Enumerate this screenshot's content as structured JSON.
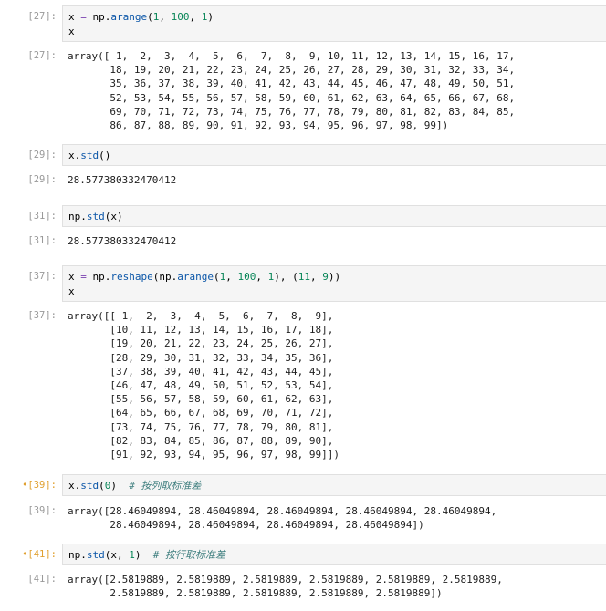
{
  "cells": [
    {
      "type": "in",
      "prompt": "[27]:",
      "code": [
        [
          {
            "t": "x ",
            "c": "kw"
          },
          {
            "t": "=",
            "c": "op"
          },
          {
            "t": " np.",
            "c": "kw"
          },
          {
            "t": "arange",
            "c": "fn"
          },
          {
            "t": "(",
            "c": "kw"
          },
          {
            "t": "1",
            "c": "num"
          },
          {
            "t": ", ",
            "c": "kw"
          },
          {
            "t": "100",
            "c": "num"
          },
          {
            "t": ", ",
            "c": "kw"
          },
          {
            "t": "1",
            "c": "num"
          },
          {
            "t": ")",
            "c": "kw"
          }
        ],
        [
          {
            "t": "x",
            "c": "kw"
          }
        ]
      ]
    },
    {
      "type": "out",
      "prompt": "[27]:",
      "lines": [
        "array([ 1,  2,  3,  4,  5,  6,  7,  8,  9, 10, 11, 12, 13, 14, 15, 16, 17,",
        "       18, 19, 20, 21, 22, 23, 24, 25, 26, 27, 28, 29, 30, 31, 32, 33, 34,",
        "       35, 36, 37, 38, 39, 40, 41, 42, 43, 44, 45, 46, 47, 48, 49, 50, 51,",
        "       52, 53, 54, 55, 56, 57, 58, 59, 60, 61, 62, 63, 64, 65, 66, 67, 68,",
        "       69, 70, 71, 72, 73, 74, 75, 76, 77, 78, 79, 80, 81, 82, 83, 84, 85,",
        "       86, 87, 88, 89, 90, 91, 92, 93, 94, 95, 96, 97, 98, 99])"
      ]
    },
    {
      "type": "in",
      "prompt": "[29]:",
      "code": [
        [
          {
            "t": "x.",
            "c": "kw"
          },
          {
            "t": "std",
            "c": "fn"
          },
          {
            "t": "()",
            "c": "kw"
          }
        ]
      ]
    },
    {
      "type": "out",
      "prompt": "[29]:",
      "lines": [
        "28.577380332470412"
      ]
    },
    {
      "type": "in",
      "prompt": "[31]:",
      "code": [
        [
          {
            "t": "np.",
            "c": "kw"
          },
          {
            "t": "std",
            "c": "fn"
          },
          {
            "t": "(x)",
            "c": "kw"
          }
        ]
      ]
    },
    {
      "type": "out",
      "prompt": "[31]:",
      "lines": [
        "28.577380332470412"
      ]
    },
    {
      "type": "in",
      "prompt": "[37]:",
      "code": [
        [
          {
            "t": "x ",
            "c": "kw"
          },
          {
            "t": "=",
            "c": "op"
          },
          {
            "t": " np.",
            "c": "kw"
          },
          {
            "t": "reshape",
            "c": "fn"
          },
          {
            "t": "(np.",
            "c": "kw"
          },
          {
            "t": "arange",
            "c": "fn"
          },
          {
            "t": "(",
            "c": "kw"
          },
          {
            "t": "1",
            "c": "num"
          },
          {
            "t": ", ",
            "c": "kw"
          },
          {
            "t": "100",
            "c": "num"
          },
          {
            "t": ", ",
            "c": "kw"
          },
          {
            "t": "1",
            "c": "num"
          },
          {
            "t": "), (",
            "c": "kw"
          },
          {
            "t": "11",
            "c": "num"
          },
          {
            "t": ", ",
            "c": "kw"
          },
          {
            "t": "9",
            "c": "num"
          },
          {
            "t": "))",
            "c": "kw"
          }
        ],
        [
          {
            "t": "x",
            "c": "kw"
          }
        ]
      ]
    },
    {
      "type": "out",
      "prompt": "[37]:",
      "lines": [
        "array([[ 1,  2,  3,  4,  5,  6,  7,  8,  9],",
        "       [10, 11, 12, 13, 14, 15, 16, 17, 18],",
        "       [19, 20, 21, 22, 23, 24, 25, 26, 27],",
        "       [28, 29, 30, 31, 32, 33, 34, 35, 36],",
        "       [37, 38, 39, 40, 41, 42, 43, 44, 45],",
        "       [46, 47, 48, 49, 50, 51, 52, 53, 54],",
        "       [55, 56, 57, 58, 59, 60, 61, 62, 63],",
        "       [64, 65, 66, 67, 68, 69, 70, 71, 72],",
        "       [73, 74, 75, 76, 77, 78, 79, 80, 81],",
        "       [82, 83, 84, 85, 86, 87, 88, 89, 90],",
        "       [91, 92, 93, 94, 95, 96, 97, 98, 99]])"
      ]
    },
    {
      "type": "in",
      "prompt": "[39]:",
      "unsaved": true,
      "code": [
        [
          {
            "t": "x.",
            "c": "kw"
          },
          {
            "t": "std",
            "c": "fn"
          },
          {
            "t": "(",
            "c": "kw"
          },
          {
            "t": "0",
            "c": "num"
          },
          {
            "t": ")  ",
            "c": "kw"
          },
          {
            "t": "# 按列取标准差",
            "c": "cm"
          }
        ]
      ]
    },
    {
      "type": "out",
      "prompt": "[39]:",
      "lines": [
        "array([28.46049894, 28.46049894, 28.46049894, 28.46049894, 28.46049894,",
        "       28.46049894, 28.46049894, 28.46049894, 28.46049894])"
      ]
    },
    {
      "type": "in",
      "prompt": "[41]:",
      "unsaved": true,
      "code": [
        [
          {
            "t": "np.",
            "c": "kw"
          },
          {
            "t": "std",
            "c": "fn"
          },
          {
            "t": "(x, ",
            "c": "kw"
          },
          {
            "t": "1",
            "c": "num"
          },
          {
            "t": ")  ",
            "c": "kw"
          },
          {
            "t": "# 按行取标准差",
            "c": "cm"
          }
        ]
      ]
    },
    {
      "type": "out",
      "prompt": "[41]:",
      "lines": [
        "array([2.5819889, 2.5819889, 2.5819889, 2.5819889, 2.5819889, 2.5819889,",
        "       2.5819889, 2.5819889, 2.5819889, 2.5819889, 2.5819889])"
      ]
    }
  ]
}
